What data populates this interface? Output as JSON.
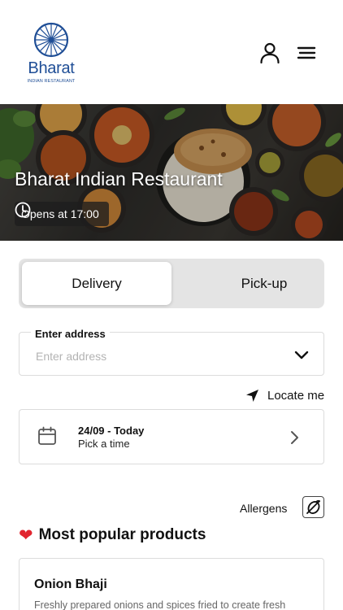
{
  "brand": {
    "name": "Bharat",
    "tagline": "INDIAN RESTAURANT",
    "color": "#1f4e96"
  },
  "header": {
    "account_icon": "user-icon",
    "menu_icon": "hamburger-menu-icon"
  },
  "hero": {
    "title": "Bharat Indian Restaurant",
    "hours_icon": "clock-icon",
    "hours_text": "Opens at 17:00"
  },
  "order_mode": {
    "options": [
      "Delivery",
      "Pick-up"
    ],
    "selected": "Delivery"
  },
  "address": {
    "label": "Enter address",
    "placeholder": "Enter address",
    "value": ""
  },
  "locate": {
    "icon": "location-arrow-icon",
    "label": "Locate me"
  },
  "schedule": {
    "date_text": "24/09 - Today",
    "time_text": "Pick a time",
    "icon": "calendar-icon"
  },
  "allergens": {
    "label": "Allergens",
    "icon": "allergen-icon"
  },
  "popular": {
    "icon": "heart-icon",
    "heading": "Most popular products",
    "items": [
      {
        "name": "Onion Bhaji",
        "description": "Freshly prepared onions and spices fried to create fresh"
      }
    ]
  }
}
